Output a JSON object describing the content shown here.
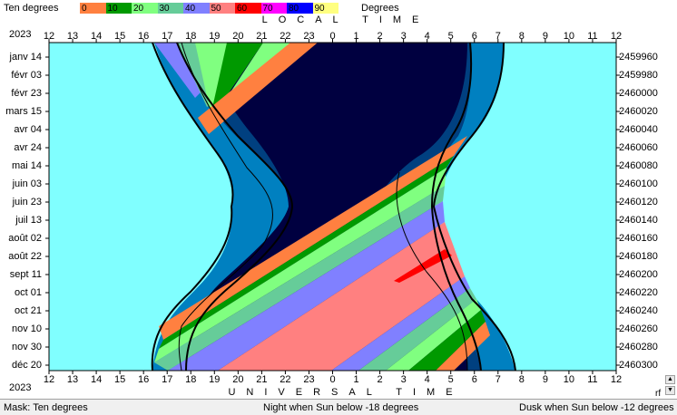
{
  "legend": {
    "title": "Ten degrees",
    "units": "Degrees",
    "bands": [
      {
        "label": "0",
        "color": "#ff8040"
      },
      {
        "label": "10",
        "color": "#009900"
      },
      {
        "label": "20",
        "color": "#80ff80"
      },
      {
        "label": "30",
        "color": "#66cc99"
      },
      {
        "label": "40",
        "color": "#8080ff"
      },
      {
        "label": "50",
        "color": "#ff8080"
      },
      {
        "label": "60",
        "color": "#ff0000"
      },
      {
        "label": "70",
        "color": "#ff00ff"
      },
      {
        "label": "80",
        "color": "#0000ff"
      },
      {
        "label": "90",
        "color": "#ffff80"
      }
    ]
  },
  "header": {
    "year_top": "2023",
    "year_bottom": "2023",
    "local_time": "LOCAL TIME",
    "universal_time": "UNIVERSAL TIME"
  },
  "axes": {
    "hours": [
      "12",
      "13",
      "14",
      "15",
      "16",
      "17",
      "18",
      "19",
      "20",
      "21",
      "22",
      "23",
      "0",
      "1",
      "2",
      "3",
      "4",
      "5",
      "6",
      "7",
      "8",
      "9",
      "10",
      "11",
      "12"
    ],
    "dates": [
      "janv 14",
      "févr 03",
      "févr 23",
      "mars 15",
      "avr 04",
      "avr 24",
      "mai 14",
      "juin 03",
      "juin 23",
      "juil 13",
      "août 02",
      "août 22",
      "sept 11",
      "oct 01",
      "oct 21",
      "nov 10",
      "nov 30",
      "déc 20"
    ],
    "julian_days": [
      "2459960",
      "2459980",
      "2460000",
      "2460020",
      "2460040",
      "2460060",
      "2460080",
      "2460100",
      "2460120",
      "2460140",
      "2460160",
      "2460180",
      "2460200",
      "2460220",
      "2460240",
      "2460260",
      "2460280",
      "2460300"
    ]
  },
  "colors": {
    "day": "#80ffff",
    "civil": "#0080c0",
    "nautical": "#004080",
    "night": "#000040"
  },
  "status": {
    "mask": "Mask:  Ten degrees",
    "night": "Night when Sun below -18 degrees",
    "dusk": "Dusk when Sun below -12 degrees"
  },
  "scroll": {
    "up_icon": "▲",
    "down_icon": "▼",
    "corner": "rf"
  }
}
